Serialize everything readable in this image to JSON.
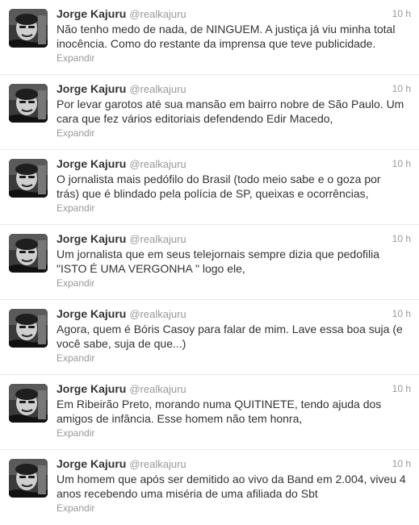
{
  "tweets": [
    {
      "name": "Jorge Kajuru",
      "handle": "@realkajuru",
      "time": "10 h",
      "text": "Não tenho medo de nada, de NINGUEM. A justiça já viu minha total\ninocência. Como do restante da imprensa que teve publicidade.",
      "expand": "Expandir",
      "avatar_icon": "profile-photo"
    },
    {
      "name": "Jorge Kajuru",
      "handle": "@realkajuru",
      "time": "10 h",
      "text": "Por levar garotos até sua mansão em bairro nobre de São Paulo. Um\ncara que fez vários editoriais defendendo Edir Macedo,",
      "expand": "Expandir",
      "avatar_icon": "profile-photo"
    },
    {
      "name": "Jorge Kajuru",
      "handle": "@realkajuru",
      "time": "10 h",
      "text": "O jornalista mais pedófilo do Brasil (todo meio sabe e o goza por\ntrás) que é blindado pela polícia de SP, queixas e ocorrências,",
      "expand": "Expandir",
      "avatar_icon": "profile-photo"
    },
    {
      "name": "Jorge Kajuru",
      "handle": "@realkajuru",
      "time": "10 h",
      "text": "Um jornalista que em seus telejornais sempre dizia que pedofilia\n\"ISTO É UMA VERGONHA \" logo ele,",
      "expand": "Expandir",
      "avatar_icon": "profile-photo"
    },
    {
      "name": "Jorge Kajuru",
      "handle": "@realkajuru",
      "time": "10 h",
      "text": "Agora, quem é Bóris Casoy para falar de mim. Lave essa boa suja (e\nvocê sabe, suja de que...)",
      "expand": "Expandir",
      "avatar_icon": "profile-photo"
    },
    {
      "name": "Jorge Kajuru",
      "handle": "@realkajuru",
      "time": "10 h",
      "text": "Em Ribeirão Preto, morando numa QUITINETE, tendo ajuda dos\namigos de infância. Esse homem não tem honra,",
      "expand": "Expandir",
      "avatar_icon": "profile-photo"
    },
    {
      "name": "Jorge Kajuru",
      "handle": "@realkajuru",
      "time": "10 h",
      "text": "Um homem que após ser demitido ao vivo da Band em 2.004, viveu 4\nanos recebendo uma miséria de uma afiliada do Sbt",
      "expand": "Expandir",
      "avatar_icon": "profile-photo"
    }
  ],
  "colors": {
    "text": "#333333",
    "muted": "#999999",
    "divider": "#e8e8e8"
  }
}
